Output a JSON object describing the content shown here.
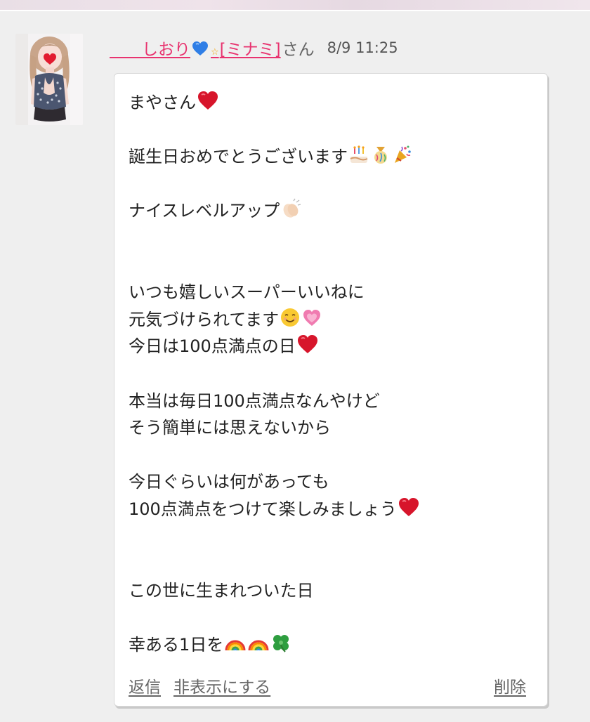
{
  "header": {
    "username_prefix": "　　",
    "username_main": "しおり",
    "username_bracket": "[ミナミ]",
    "san": "さん",
    "timestamp": "8/9 11:25"
  },
  "message": {
    "lines": [
      {
        "text": "まやさん",
        "emojis": [
          "red-heart"
        ]
      },
      {
        "text": "",
        "emojis": []
      },
      {
        "text": "誕生日おめでとうございます",
        "emojis": [
          "birthday-cake",
          "confetti-ball",
          "party-popper"
        ]
      },
      {
        "text": "",
        "emojis": []
      },
      {
        "text": "ナイスレベルアップ",
        "emojis": [
          "clapping-hands"
        ]
      },
      {
        "text": "",
        "emojis": []
      },
      {
        "text": "",
        "emojis": []
      },
      {
        "text": "いつも嬉しいスーパーいいねに",
        "emojis": []
      },
      {
        "text": "元気づけられてます",
        "emojis": [
          "smiling-face",
          "growing-heart"
        ]
      },
      {
        "text": "今日は100点満点の日",
        "emojis": [
          "red-heart"
        ]
      },
      {
        "text": "",
        "emojis": []
      },
      {
        "text": "本当は毎日100点満点なんやけど",
        "emojis": []
      },
      {
        "text": "そう簡単には思えないから",
        "emojis": []
      },
      {
        "text": "",
        "emojis": []
      },
      {
        "text": "今日ぐらいは何があっても",
        "emojis": []
      },
      {
        "text": "100点満点をつけて楽しみましょう",
        "emojis": [
          "red-heart"
        ]
      },
      {
        "text": "",
        "emojis": []
      },
      {
        "text": "",
        "emojis": []
      },
      {
        "text": "この世に生まれついた日",
        "emojis": []
      },
      {
        "text": "",
        "emojis": []
      },
      {
        "text": "幸ある1日を",
        "emojis": [
          "rainbow",
          "rainbow",
          "four-leaf-clover"
        ]
      }
    ]
  },
  "actions": {
    "reply": "返信",
    "hide": "非表示にする",
    "delete": "削除"
  },
  "icons": {
    "username_heart": "blue-heart-icon",
    "username_star": "white-star-icon"
  },
  "colors": {
    "username": "#e8336f",
    "background": "#efefef",
    "bubble": "#ffffff"
  }
}
